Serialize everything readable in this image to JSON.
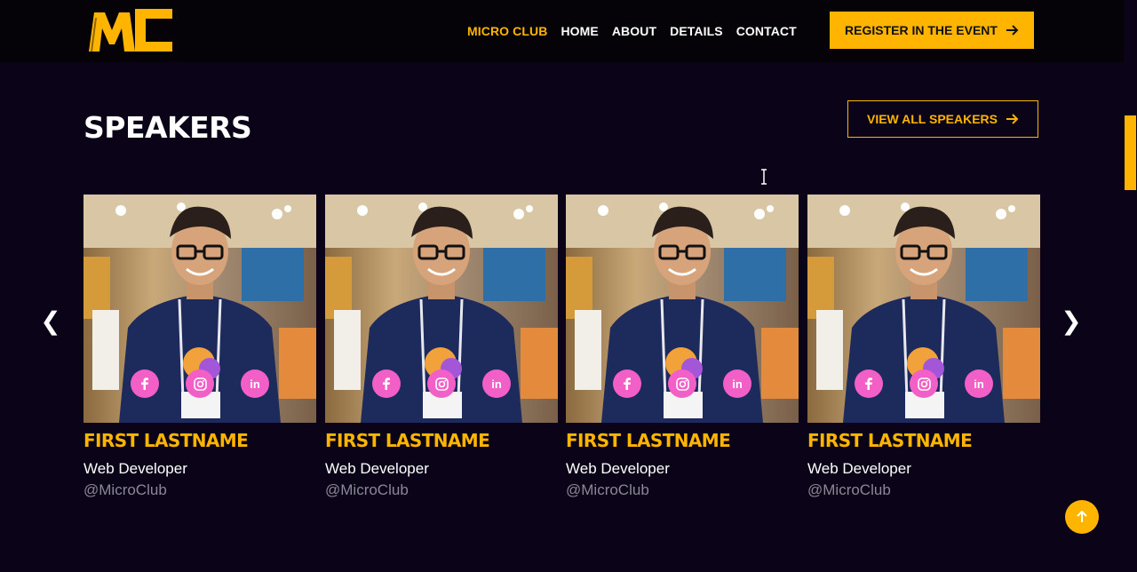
{
  "header": {
    "logo_text": "MC",
    "nav": [
      {
        "label": "MICRO CLUB",
        "active": true
      },
      {
        "label": "HOME",
        "active": false
      },
      {
        "label": "ABOUT",
        "active": false
      },
      {
        "label": "DETAILS",
        "active": false
      },
      {
        "label": "CONTACT",
        "active": false
      }
    ],
    "register_label": "REGISTER IN THE EVENT"
  },
  "speakers": {
    "title": "SPEAKERS",
    "view_all_label": "VIEW ALL SPEAKERS",
    "prev_icon": "chevron-left-icon",
    "next_icon": "chevron-right-icon",
    "cards": [
      {
        "name": "FIRST LASTNAME",
        "role": "Web Developer",
        "handle": "@MicroClub"
      },
      {
        "name": "FIRST LASTNAME",
        "role": "Web Developer",
        "handle": "@MicroClub"
      },
      {
        "name": "FIRST LASTNAME",
        "role": "Web Developer",
        "handle": "@MicroClub"
      },
      {
        "name": "FIRST LASTNAME",
        "role": "Web Developer",
        "handle": "@MicroClub"
      }
    ],
    "social_icons": [
      "facebook-icon",
      "instagram-icon",
      "linkedin-icon"
    ]
  },
  "colors": {
    "accent": "#ffb400",
    "social": "#f25fc6",
    "background": "#0b0418",
    "header": "#050307",
    "muted": "#8a8796"
  },
  "back_to_top_icon": "arrow-up-icon"
}
